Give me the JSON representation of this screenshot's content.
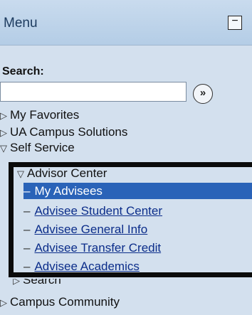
{
  "menu": {
    "title": "Menu",
    "collapse_symbol": "−"
  },
  "search": {
    "label": "Search:",
    "value": "",
    "go_symbol": "»"
  },
  "tree": {
    "my_favorites": "My Favorites",
    "ua_campus_solutions": "UA Campus Solutions",
    "self_service": "Self Service",
    "advisor_center": "Advisor Center",
    "my_advisees": "My Advisees",
    "advisee_student_center": "Advisee Student Center",
    "advisee_general_info": "Advisee General Info",
    "advisee_transfer_credit": "Advisee Transfer Credit",
    "advisee_academics": "Advisee Academics",
    "search": "Search",
    "campus_community": "Campus Community"
  },
  "icons": {
    "collapsed": "triangle-right-icon",
    "expanded": "triangle-down-icon"
  },
  "colors": {
    "selected_bg": "#2a63b8",
    "link": "#0b2d8a",
    "panel_bg": "#d3e0ee",
    "highlight_border": "#0b0b0b"
  }
}
